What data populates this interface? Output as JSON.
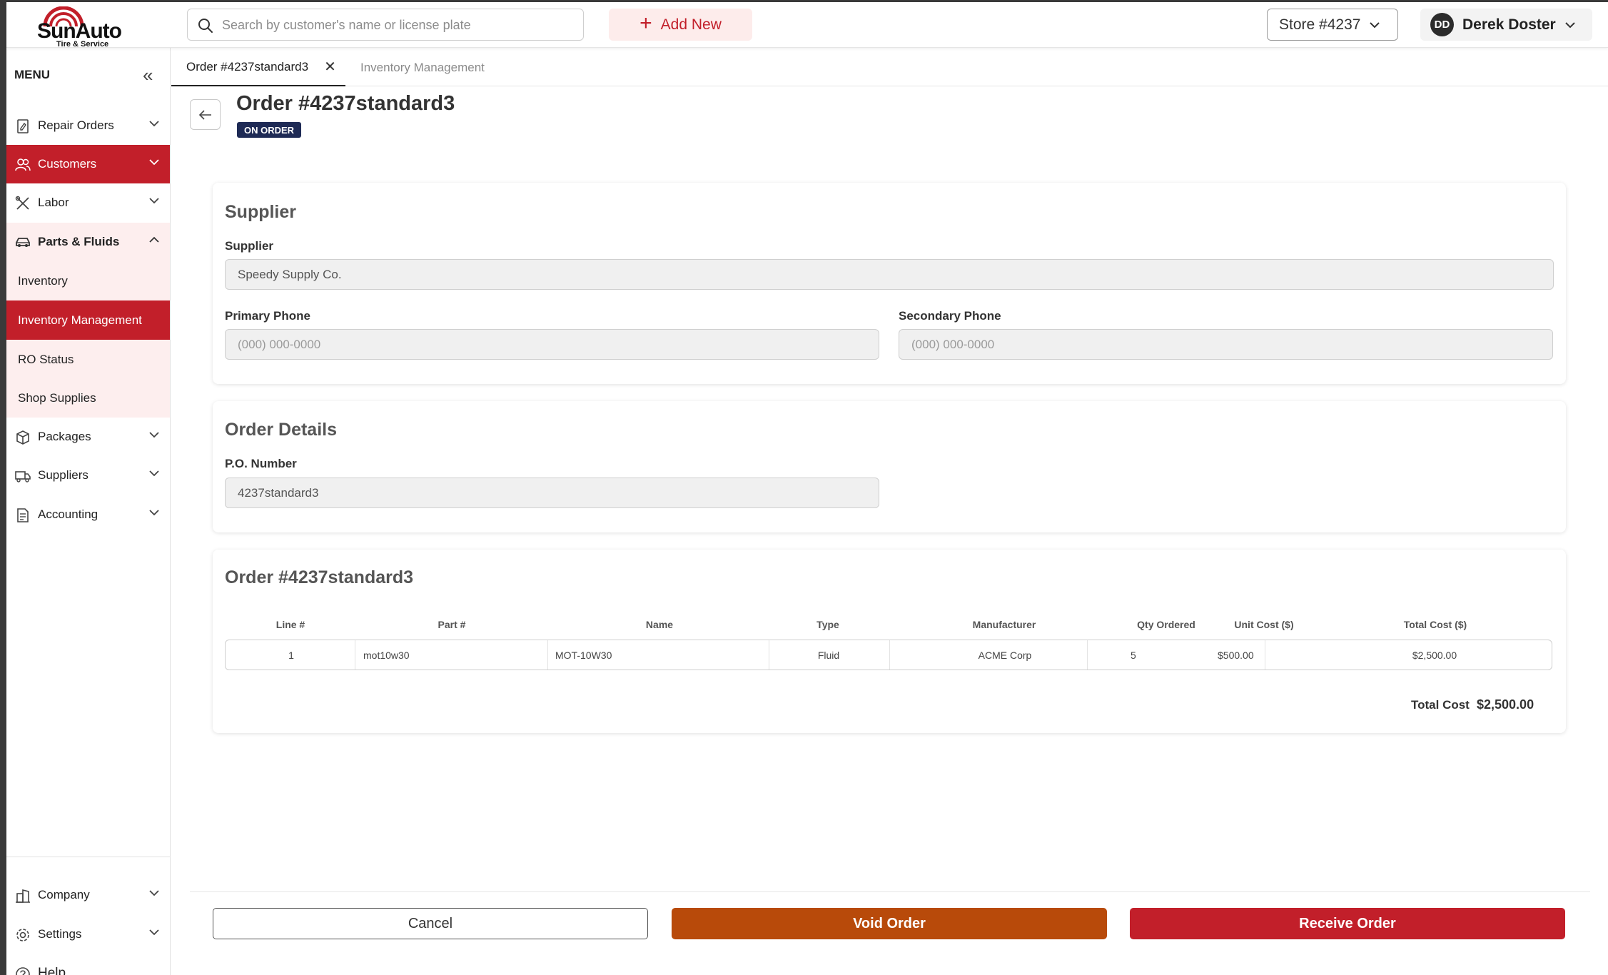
{
  "header": {
    "logo_text": "SunAuto",
    "logo_subtext": "Tire & Service",
    "search_placeholder": "Search by customer's name or license plate",
    "add_new_label": "Add New",
    "store_label": "Store #4237",
    "user_initials": "DD",
    "user_name": "Derek Doster"
  },
  "sidebar": {
    "menu_title": "MENU",
    "items": [
      {
        "label": "Repair Orders",
        "icon": "repair-orders-icon"
      },
      {
        "label": "Customers",
        "icon": "customers-icon"
      },
      {
        "label": "Labor",
        "icon": "labor-icon"
      },
      {
        "label": "Parts & Fluids",
        "icon": "car-icon"
      },
      {
        "label": "Packages",
        "icon": "package-icon"
      },
      {
        "label": "Suppliers",
        "icon": "truck-icon"
      },
      {
        "label": "Accounting",
        "icon": "accounting-icon"
      }
    ],
    "sub_items": [
      {
        "label": "Inventory"
      },
      {
        "label": "Inventory Management"
      },
      {
        "label": "RO Status"
      },
      {
        "label": "Shop Supplies"
      }
    ],
    "bottom_items": [
      {
        "label": "Company",
        "icon": "building-icon"
      },
      {
        "label": "Settings",
        "icon": "gear-icon"
      },
      {
        "label": "Help",
        "icon": "help-icon"
      }
    ]
  },
  "tabs": [
    {
      "label": "Order #4237standard3"
    },
    {
      "label": "Inventory Management"
    }
  ],
  "page": {
    "title": "Order #4237standard3",
    "status": "ON ORDER"
  },
  "supplier_card": {
    "title": "Supplier",
    "supplier_label": "Supplier",
    "supplier_value": "Speedy Supply Co.",
    "primary_phone_label": "Primary Phone",
    "primary_phone_placeholder": "(000) 000-0000",
    "secondary_phone_label": "Secondary Phone",
    "secondary_phone_placeholder": "(000) 000-0000"
  },
  "order_details_card": {
    "title": "Order Details",
    "po_label": "P.O. Number",
    "po_value": "4237standard3"
  },
  "order_table_card": {
    "title": "Order #4237standard3",
    "columns": [
      "Line #",
      "Part #",
      "Name",
      "Type",
      "Manufacturer",
      "Qty Ordered",
      "Unit Cost ($)",
      "Total Cost ($)"
    ],
    "rows": [
      {
        "line": "1",
        "part": "mot10w30",
        "name": "MOT-10W30",
        "type": "Fluid",
        "manufacturer": "ACME Corp",
        "qty": "5",
        "unit_cost": "$500.00",
        "total_cost": "$2,500.00"
      }
    ],
    "total_label": "Total Cost",
    "total_value": "$2,500.00"
  },
  "footer": {
    "cancel_label": "Cancel",
    "void_label": "Void Order",
    "receive_label": "Receive Order"
  },
  "colors": {
    "brand_red": "#c21f2a",
    "void_orange": "#b84a0a",
    "badge_navy": "#1e2a55",
    "submenu_bg": "#fdeeee"
  }
}
